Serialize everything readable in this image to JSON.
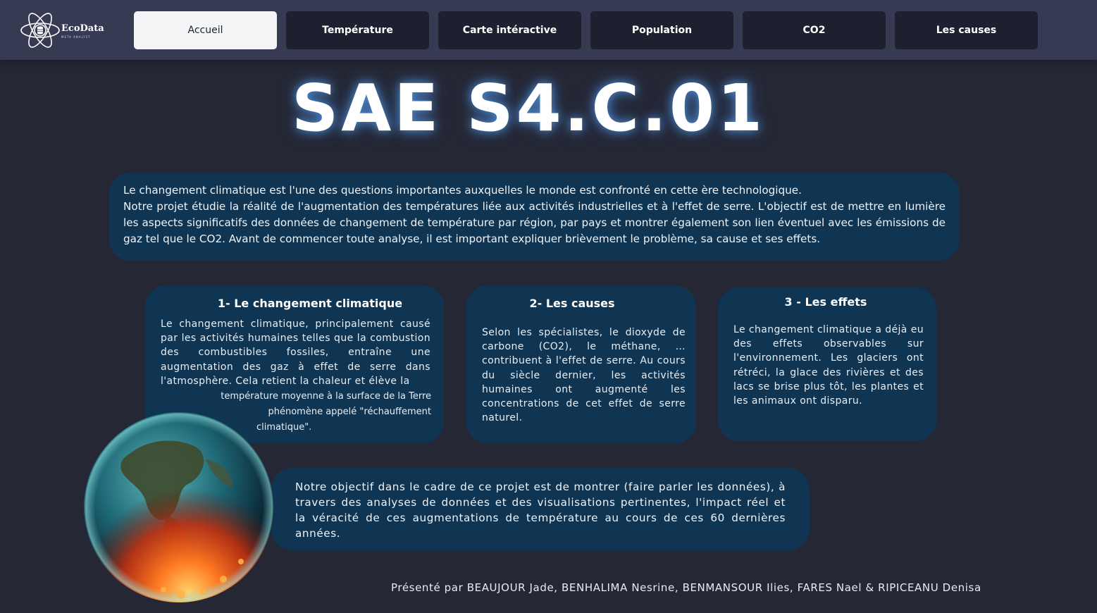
{
  "brand": {
    "name": "EcoData",
    "tagline": "META ANALYST",
    "logo_icon": "atom-database-icon"
  },
  "nav": {
    "items": [
      {
        "label": "Accueil",
        "active": true
      },
      {
        "label": "Température",
        "active": false
      },
      {
        "label": "Carte intéractive",
        "active": false
      },
      {
        "label": "Population",
        "active": false
      },
      {
        "label": "CO2",
        "active": false
      },
      {
        "label": "Les causes",
        "active": false
      }
    ]
  },
  "title": "SAE S4.C.01",
  "intro": {
    "line1": "Le changement climatique est l'une des questions importantes auxquelles le monde est confronté en cette ère technologique.",
    "line2": "Notre projet étudie la réalité de l'augmentation des températures liée aux activités industrielles et à l'effet de serre. L'objectif est de mettre en lumière les aspects significatifs des données de changement de température par région, par pays et montrer également son lien éventuel avec les émissions de gaz tel que le CO2. Avant de commencer toute analyse, il est important expliquer brièvement le problème, sa cause et ses effets."
  },
  "cards": [
    {
      "title": "1- Le changement climatique",
      "body": "Le changement climatique, principalement causé par les activités humaines telles que la combustion des combustibles fossiles, entraîne une augmentation des gaz à effet de serre dans l'atmosphère. Cela  retient la  chaleur et élève la",
      "tail1": "température moyenne à la surface de la Terre",
      "tail2": "phénomène appelé \"réchauffement",
      "tail3": "climatique\"."
    },
    {
      "title": "2- Les causes",
      "body": "Selon les spécialistes, le dioxyde de carbone (CO2), le méthane, … contribuent à l'effet de serre. Au cours du siècle dernier, les activités humaines ont augmenté les concentrations de cet effet de serre naturel."
    },
    {
      "title": "3 - Les effets",
      "body": "Le changement climatique a déjà eu des effets observables sur l'environnement. Les glaciers ont rétréci, la glace des rivières et des lacs se brise plus tôt, les plantes et les animaux ont disparu."
    }
  ],
  "objective": "Notre objectif dans le cadre de ce projet est de montrer (faire parler les données), à travers des analyses de données et des visualisations pertinentes, l'impact réel et la véracité de ces augmentations de température au cours de ces 60 dernières années.",
  "footer": "Présenté par BEAUJOUR Jade, BENHALIMA Nesrine, BENMANSOUR Ilies, FARES Nael & RIPICEANU Denisa",
  "colors": {
    "background": "#252734",
    "topbar": "#363a52",
    "nav_button": "#1e2030",
    "nav_active": "#f4f5f7",
    "card": "#0f3552",
    "title_glow": "#5aaaff"
  }
}
